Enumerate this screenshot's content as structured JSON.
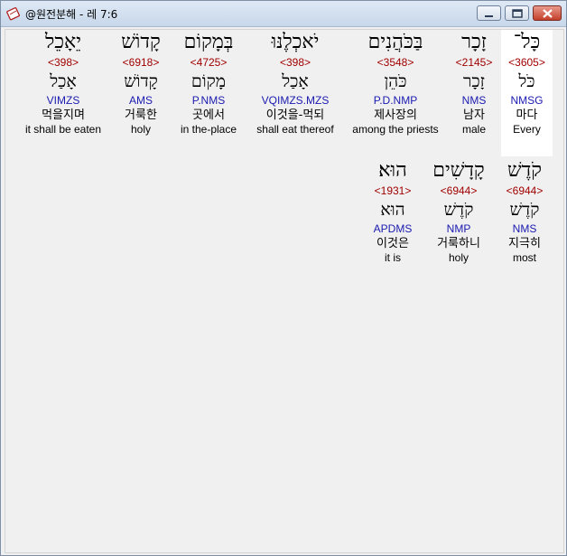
{
  "window": {
    "title": "@원전분해 - 레 7:6",
    "icon": "app-book-icon"
  },
  "rows": [
    [
      {
        "hebrew": "כָּל־",
        "strong": "<3605>",
        "lemma": "כֹּל",
        "parse": "NMSG",
        "korean": "마다",
        "english": "Every",
        "selected": true
      },
      {
        "hebrew": "זָכָר",
        "strong": "<2145>",
        "lemma": "זָכָר",
        "parse": "NMS",
        "korean": "남자",
        "english": "male",
        "selected": false
      },
      {
        "hebrew": "בַּכֹּהֲנִים",
        "strong": "<3548>",
        "lemma": "כֹּהֵן",
        "parse": "P.D.NMP",
        "korean": "제사장의",
        "english": "among the priests",
        "selected": false
      },
      {
        "hebrew": "יֹאכְלֶנּוּ",
        "strong": "<398>",
        "lemma": "אָכַל",
        "parse": "VQIMZS.MZS",
        "korean": "이것을-먹되",
        "english": "shall eat thereof",
        "selected": false
      },
      {
        "hebrew": "בְּמָקוֹם",
        "strong": "<4725>",
        "lemma": "מָקוֹם",
        "parse": "P.NMS",
        "korean": "곳에서",
        "english": "in the-place",
        "selected": false
      },
      {
        "hebrew": "קָדוֹשׁ",
        "strong": "<6918>",
        "lemma": "קָדוֹשׁ",
        "parse": "AMS",
        "korean": "거룩한",
        "english": "holy",
        "selected": false
      },
      {
        "hebrew": "יֵאָכֵל",
        "strong": "<398>",
        "lemma": "אָכַל",
        "parse": "VIMZS",
        "korean": "먹을지며",
        "english": "it shall be eaten",
        "selected": false
      }
    ],
    [
      {
        "hebrew": "קֹדֶשׁ",
        "strong": "<6944>",
        "lemma": "קֹדֶשׁ",
        "parse": "NMS",
        "korean": "지극히",
        "english": "most",
        "selected": false
      },
      {
        "hebrew": "קָדָשִׁים",
        "strong": "<6944>",
        "lemma": "קֹדֶשׁ",
        "parse": "NMP",
        "korean": "거룩하니",
        "english": "holy",
        "selected": false
      },
      {
        "hebrew": "הוּא׃",
        "strong": "<1931>",
        "lemma": "הוּא",
        "parse": "APDMS",
        "korean": "이것은",
        "english": "it is",
        "selected": false
      }
    ]
  ]
}
